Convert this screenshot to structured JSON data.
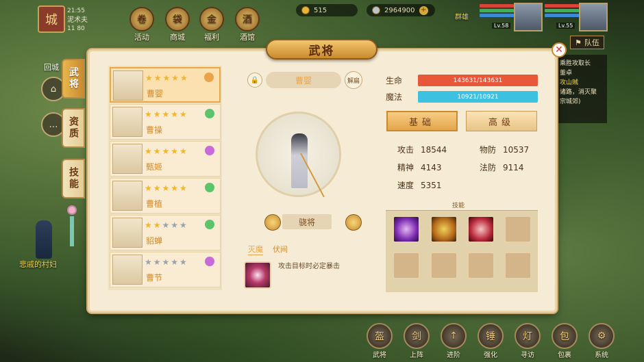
{
  "hud": {
    "time": "21:55",
    "player_name": "泥术夫",
    "player_sub": "11   80",
    "top_icons": [
      "活动",
      "商城",
      "福利",
      "酒馆"
    ],
    "gold": "515",
    "silver": "2964900",
    "top_label": "群雄",
    "portraits": [
      {
        "lv": "Lv.58"
      },
      {
        "lv": "Lv.55"
      }
    ],
    "left_btns": [
      "回城"
    ],
    "team_tab": "队伍",
    "quest_lines": [
      "乘胜攻取长",
      "董卓",
      "攻山贼",
      "诸路，消灭聚",
      "宗城郊)"
    ],
    "npc_label": "悲戚的村妇",
    "bottom_icons": [
      "武将",
      "上阵",
      "进阶",
      "强化",
      "寻访",
      "包裹",
      "系统"
    ]
  },
  "panel": {
    "title": "武将",
    "side_tabs": [
      "武将",
      "资质",
      "技能"
    ],
    "generals": [
      {
        "name": "曹婴",
        "stars": 5
      },
      {
        "name": "曹操",
        "stars": 5
      },
      {
        "name": "甄姬",
        "stars": 5
      },
      {
        "name": "曹植",
        "stars": 5
      },
      {
        "name": "貂蝉",
        "stars": 2
      },
      {
        "name": "曹节",
        "stars": 0
      }
    ],
    "selected_name": "曹婴",
    "unlock_label": "解扁",
    "rank": "骁将",
    "skill_tabs": [
      "灭魔",
      "伏间"
    ],
    "skill_desc": "攻击目标时必定暴击",
    "hp_label": "生命",
    "hp_value": "143631/143631",
    "mp_label": "魔法",
    "mp_value": "10921/10921",
    "btn_basic": "基础",
    "btn_adv": "高级",
    "attrs": [
      {
        "k": "攻击",
        "v": "18544"
      },
      {
        "k": "物防",
        "v": "10537"
      },
      {
        "k": "精神",
        "v": "4143"
      },
      {
        "k": "法防",
        "v": "9114"
      },
      {
        "k": "速度",
        "v": "5351"
      }
    ],
    "skills_title": "技能",
    "colors": {
      "hp": "#e8573a",
      "mp": "#3cc2e0",
      "accent": "#e8a44a"
    }
  }
}
